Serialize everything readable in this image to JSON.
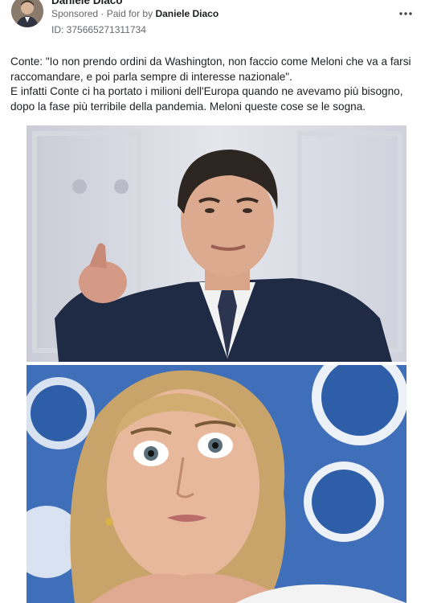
{
  "post": {
    "author": "Daniele Diaco",
    "sponsored_label": "Sponsored",
    "separator": "·",
    "paid_for_by_label": "Paid for by",
    "paid_for_by_name": "Daniele Diaco",
    "id_line": "ID: 375665271311734",
    "more_icon": "more-horizontal-icon",
    "text_paragraph_1": "Conte: \"Io non prendo ordini da Washington, non faccio come Meloni che va a farsi raccomandare, e poi parla sempre di interesse nazionale\".",
    "text_paragraph_2": "E infatti Conte ci ha portato i milioni dell'Europa quando ne avevamo più bisogno, dopo la fase più terribile della pandemia. Meloni queste cose se le sogna."
  },
  "colors": {
    "card_background": "#ffffff",
    "secondary_text": "#65676b",
    "primary_text": "#1c1e21",
    "top_photo_background": "#d9dde6",
    "bottom_photo_background": "#3f6fb8"
  }
}
